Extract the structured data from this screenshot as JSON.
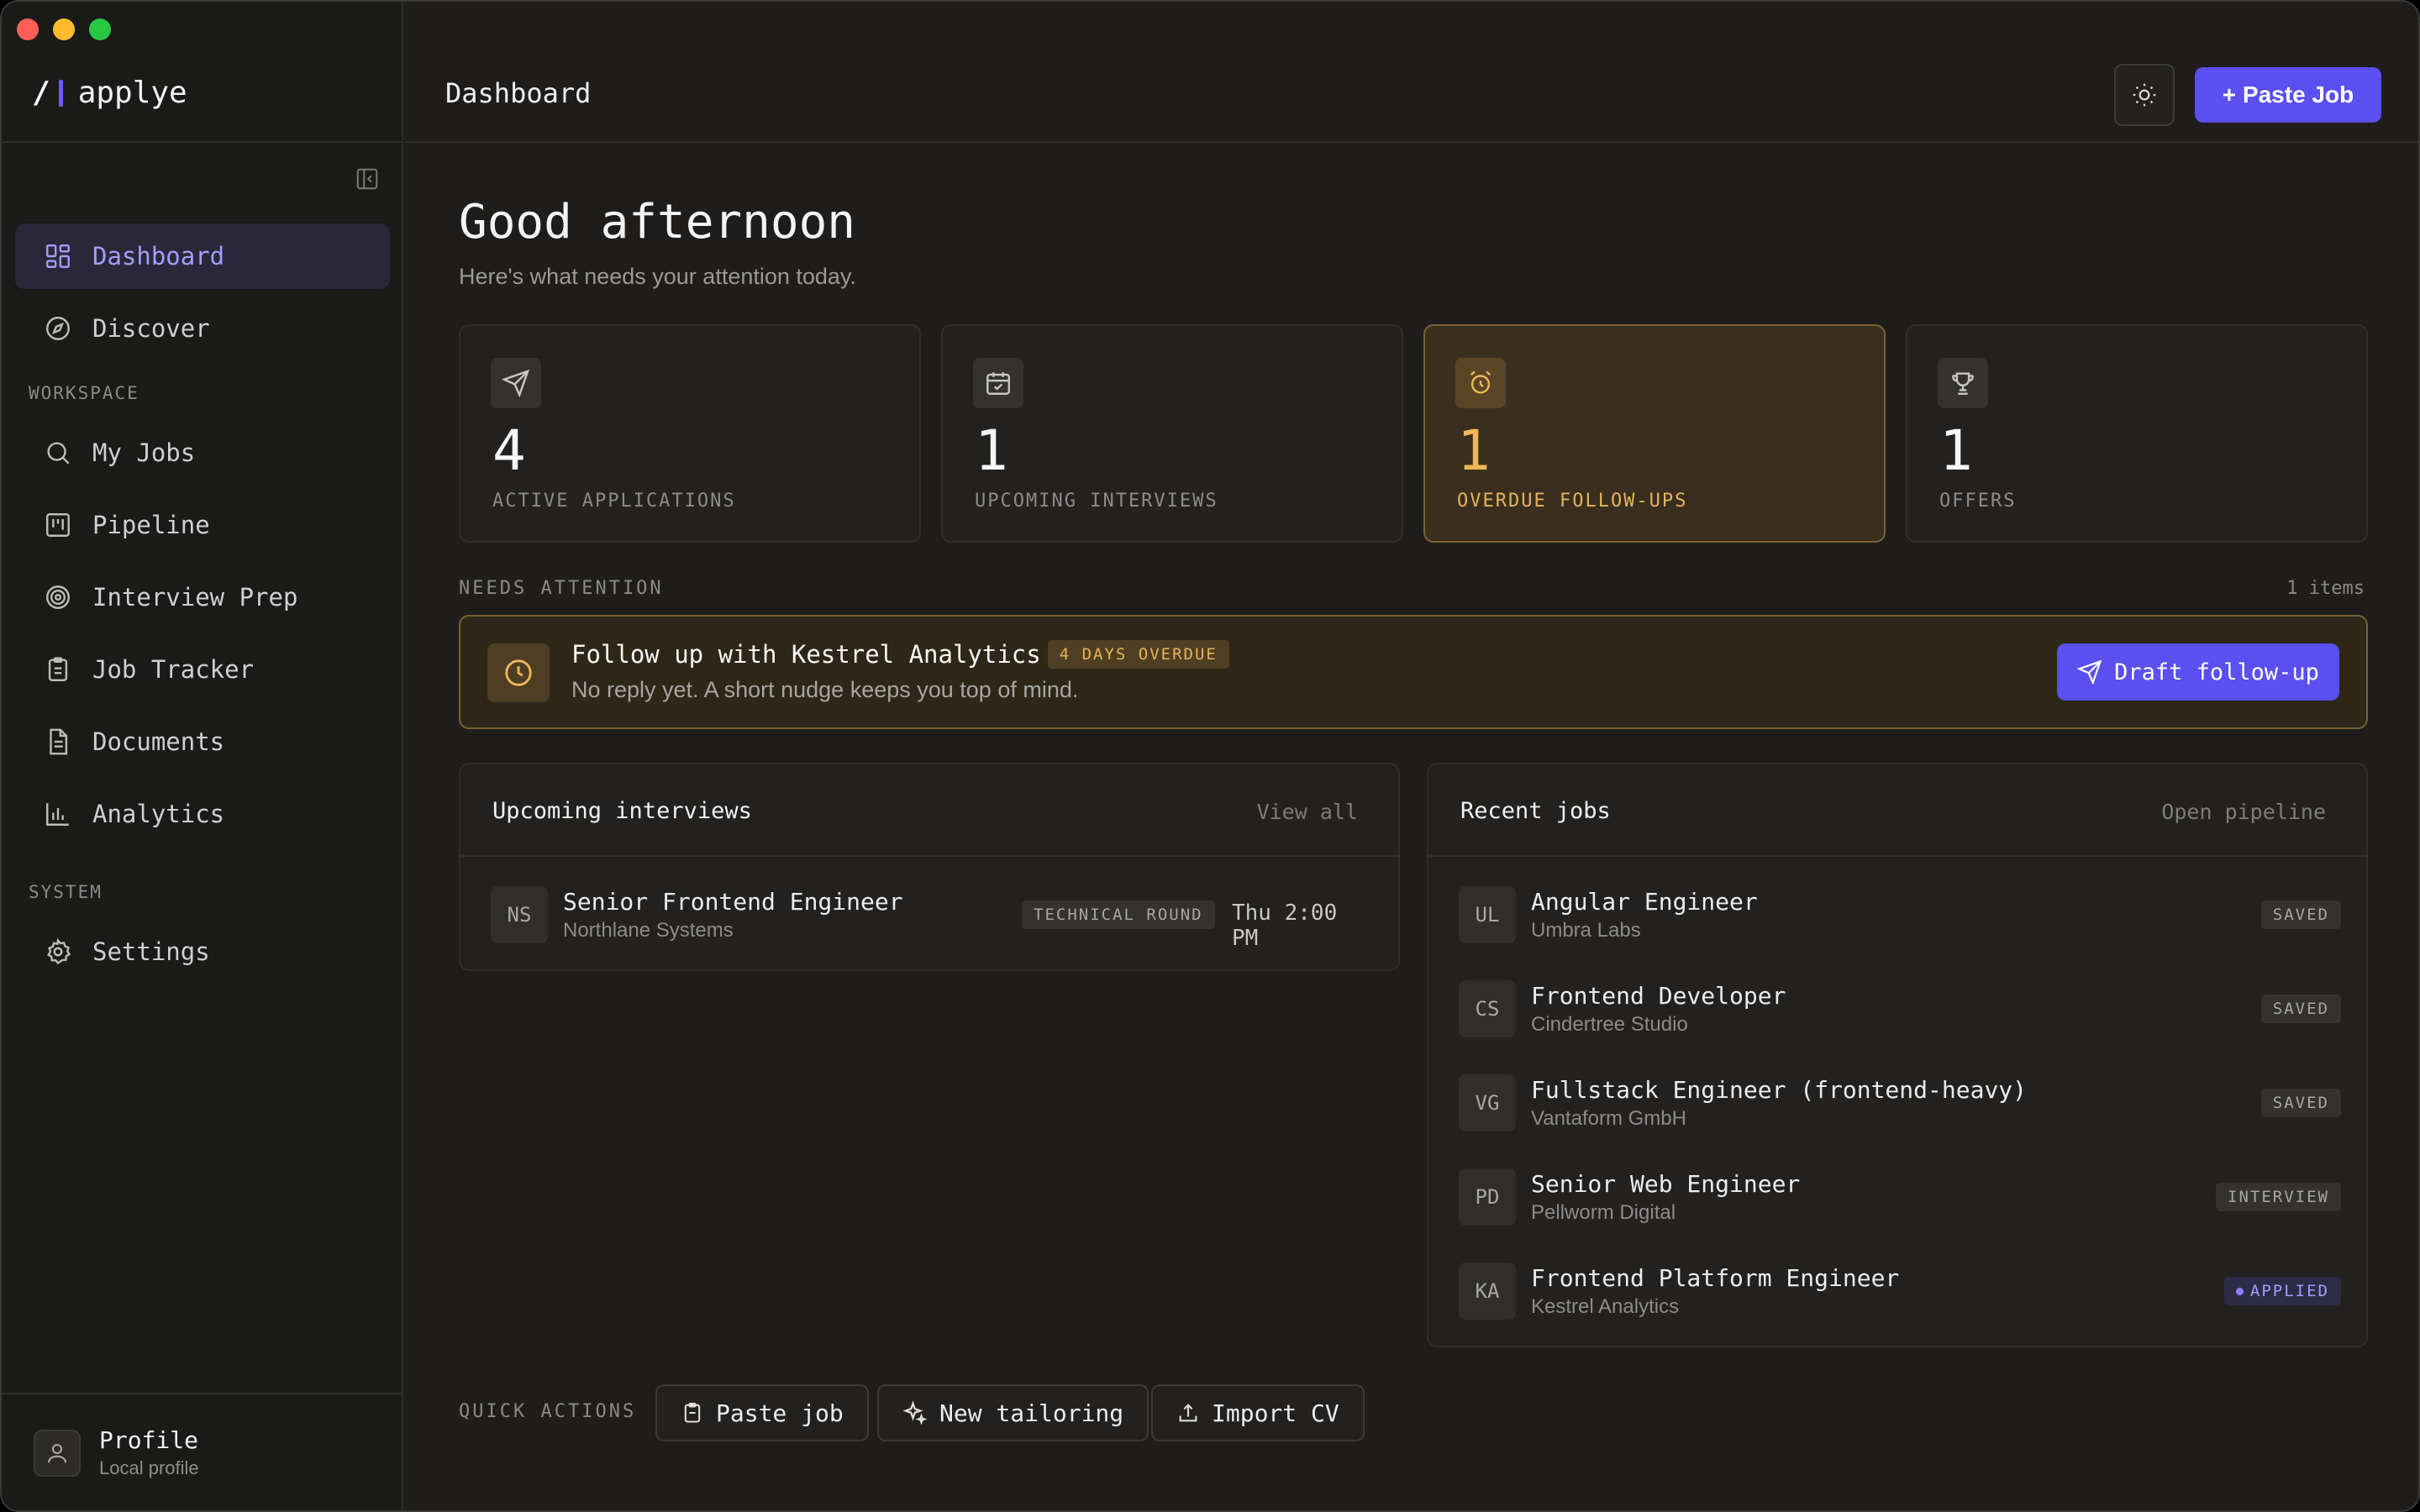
{
  "app": {
    "logo_mark": "/",
    "name": "applye"
  },
  "sidebar": {
    "items_top": [
      {
        "label": "Dashboard",
        "icon": "dashboard-icon",
        "active": true
      },
      {
        "label": "Discover",
        "icon": "compass-icon"
      }
    ],
    "workspace_label": "WORKSPACE",
    "workspace_items": [
      {
        "label": "My Jobs",
        "icon": "search-icon"
      },
      {
        "label": "Pipeline",
        "icon": "kanban-icon"
      },
      {
        "label": "Interview Prep",
        "icon": "target-icon"
      },
      {
        "label": "Job Tracker",
        "icon": "clipboard-icon"
      },
      {
        "label": "Documents",
        "icon": "document-icon"
      },
      {
        "label": "Analytics",
        "icon": "bar-chart-icon"
      }
    ],
    "system_label": "SYSTEM",
    "system_items": [
      {
        "label": "Settings",
        "icon": "gear-icon"
      }
    ],
    "profile": {
      "name": "Profile",
      "sub": "Local profile"
    }
  },
  "header": {
    "title": "Dashboard",
    "paste_job_label": "+ Paste Job"
  },
  "main": {
    "greeting": "Good afternoon",
    "greeting_sub": "Here's what needs your attention today.",
    "stats": [
      {
        "value": "4",
        "label": "ACTIVE APPLICATIONS",
        "icon": "send-icon"
      },
      {
        "value": "1",
        "label": "UPCOMING INTERVIEWS",
        "icon": "calendar-icon"
      },
      {
        "value": "1",
        "label": "OVERDUE FOLLOW-UPS",
        "icon": "alarm-clock-icon"
      },
      {
        "value": "1",
        "label": "OFFERS",
        "icon": "trophy-icon"
      }
    ],
    "needs_attention": {
      "label": "NEEDS ATTENTION",
      "count": "1 items",
      "title": "Follow up with Kestrel Analytics",
      "badge": "4 DAYS OVERDUE",
      "sub": "No reply yet. A short nudge keeps you top of mind.",
      "action": "Draft follow-up"
    },
    "interviews": {
      "title": "Upcoming interviews",
      "link": "View all",
      "rows": [
        {
          "initials": "NS",
          "title": "Senior Frontend Engineer",
          "company": "Northlane Systems",
          "tag": "TECHNICAL ROUND",
          "time": "Thu 2:00 PM"
        }
      ]
    },
    "recent_jobs": {
      "title": "Recent jobs",
      "link": "Open pipeline",
      "rows": [
        {
          "initials": "UL",
          "title": "Angular Engineer",
          "company": "Umbra Labs",
          "status": "SAVED"
        },
        {
          "initials": "CS",
          "title": "Frontend Developer",
          "company": "Cindertree Studio",
          "status": "SAVED"
        },
        {
          "initials": "VG",
          "title": "Fullstack Engineer (frontend-heavy)",
          "company": "Vantaform GmbH",
          "status": "SAVED"
        },
        {
          "initials": "PD",
          "title": "Senior Web Engineer",
          "company": "Pellworm Digital",
          "status": "INTERVIEW"
        },
        {
          "initials": "KA",
          "title": "Frontend Platform Engineer",
          "company": "Kestrel Analytics",
          "status": "APPLIED"
        }
      ]
    },
    "quick_actions": {
      "label": "QUICK ACTIONS",
      "buttons": [
        {
          "label": "Paste job",
          "icon": "clipboard-paste-icon"
        },
        {
          "label": "New tailoring",
          "icon": "sparkles-icon"
        },
        {
          "label": "Import CV",
          "icon": "upload-icon"
        }
      ]
    }
  },
  "colors": {
    "accent": "#5b4ff0",
    "accent_text": "#a59cff",
    "warning": "#f0b85a",
    "background": "#1e1d1c",
    "sidebar": "#1a1a19"
  }
}
